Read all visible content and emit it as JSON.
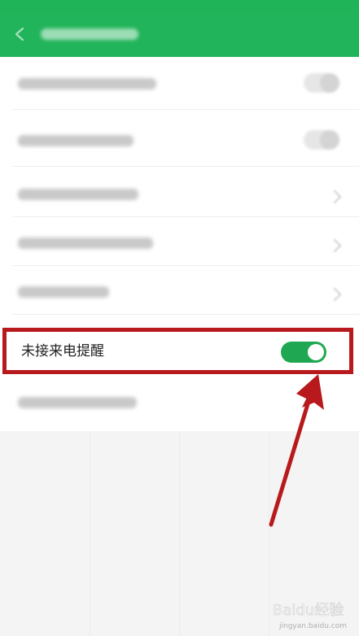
{
  "header": {
    "title": "",
    "back_icon": "back-arrow-icon",
    "color": "#22b45a"
  },
  "settings": {
    "blurred_rows": [
      {
        "label": "",
        "control": "toggle"
      },
      {
        "label": "",
        "control": "toggle"
      },
      {
        "label": "",
        "control": "chevron"
      },
      {
        "label": "",
        "control": "chevron"
      },
      {
        "label": "",
        "control": "chevron"
      },
      {
        "label": "",
        "control": "chevron"
      }
    ],
    "highlighted_row": {
      "label": "未接来电提醒",
      "toggle_on": true,
      "toggle_color": "#1fa851"
    }
  },
  "annotation": {
    "highlight_color": "#b8191c",
    "arrow_color": "#b8191c"
  },
  "watermark": {
    "brand": "Baidu经验",
    "url": "jingyan.baidu.com"
  }
}
